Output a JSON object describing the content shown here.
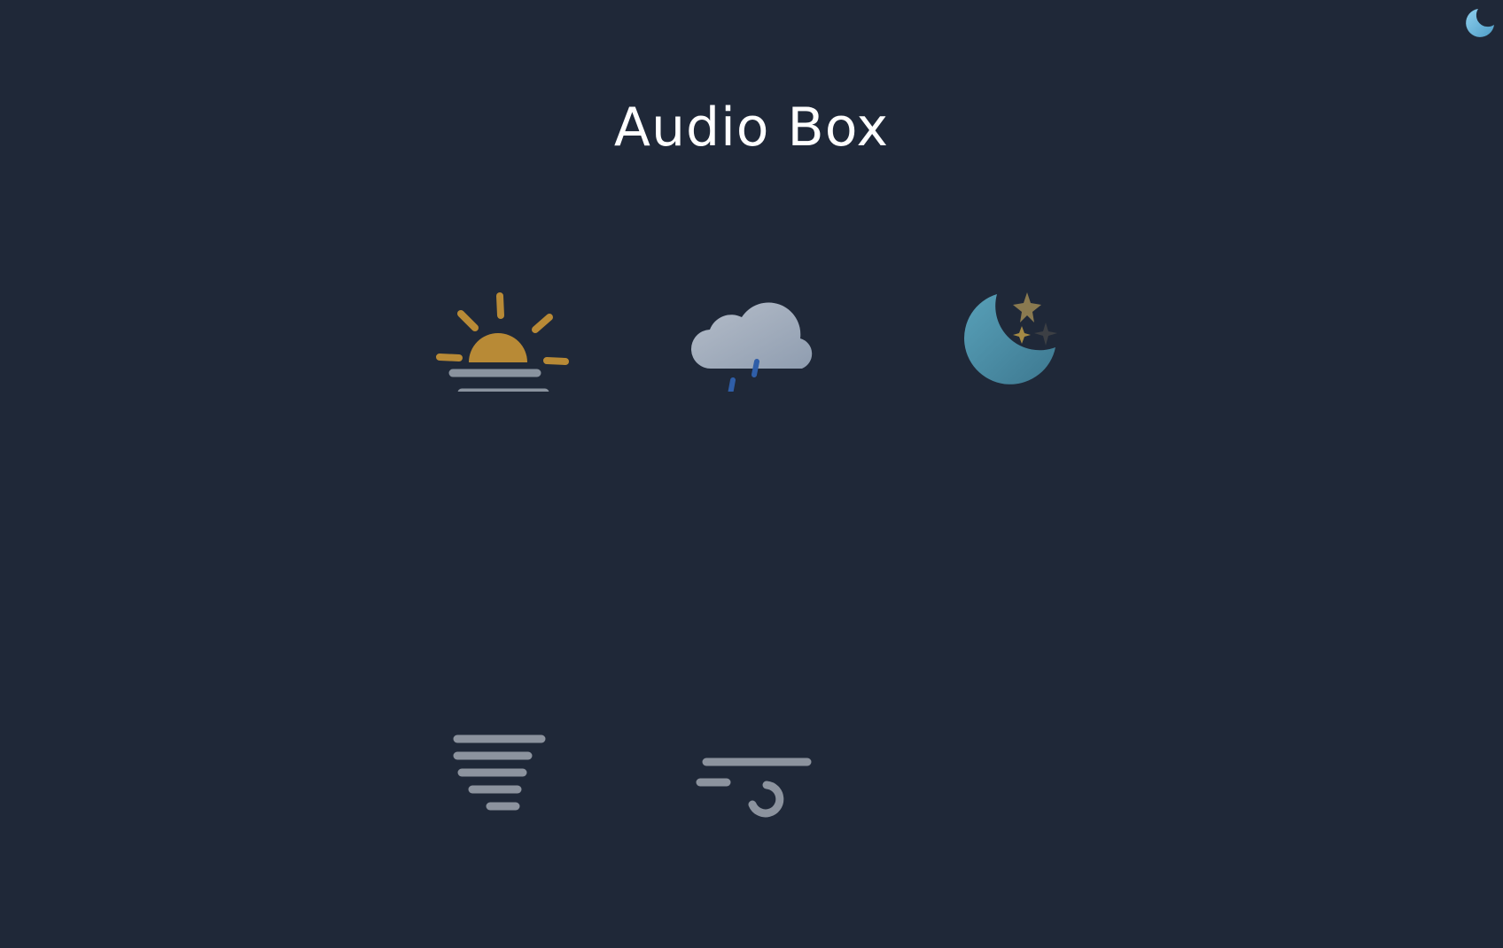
{
  "app": {
    "title": "Audio Box"
  },
  "theme_toggle": {
    "icon": "moon-icon",
    "color": "#6ab4d8"
  },
  "sounds": [
    {
      "id": "sunrise",
      "icon": "sunrise-icon",
      "color": "#b88a36"
    },
    {
      "id": "rain",
      "icon": "rain-cloud-icon",
      "color": "#9aa6b6"
    },
    {
      "id": "night",
      "icon": "moon-stars-icon",
      "color": "#4e8aa2"
    },
    {
      "id": "tornado",
      "icon": "tornado-icon",
      "color": "#8c939e"
    },
    {
      "id": "wind",
      "icon": "wind-icon",
      "color": "#8c939e"
    }
  ],
  "colors": {
    "background": "#1f2838",
    "title": "#ffffff"
  }
}
